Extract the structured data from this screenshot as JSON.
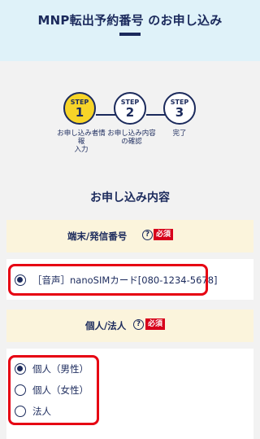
{
  "header": {
    "title": "MNP転出予約番号 のお申し込み"
  },
  "steps": [
    {
      "label": "STEP",
      "number": "1",
      "caption": "お申し込み者情\n報\n入力",
      "active": true
    },
    {
      "label": "STEP",
      "number": "2",
      "caption": "お申し込み内容\nの確認",
      "active": false
    },
    {
      "label": "STEP",
      "number": "3",
      "caption": "完了",
      "active": false
    }
  ],
  "content": {
    "section_title": "お申し込み内容",
    "line_section": {
      "heading": "端末/発信番号",
      "help_icon": "?",
      "required_badge": "必須",
      "options": [
        {
          "label": "［音声］nanoSIMカード[080-1234-5678]",
          "checked": true
        }
      ]
    },
    "type_section": {
      "heading": "個人/法人",
      "help_icon": "?",
      "required_badge": "必須",
      "options": [
        {
          "label": "個人（男性）",
          "checked": true
        },
        {
          "label": "個人（女性）",
          "checked": false
        },
        {
          "label": "法人",
          "checked": false
        }
      ]
    }
  },
  "colors": {
    "accent": "#1b2a5c",
    "highlight": "#e60012",
    "active_step": "#f7d428",
    "required": "#d7001a"
  }
}
